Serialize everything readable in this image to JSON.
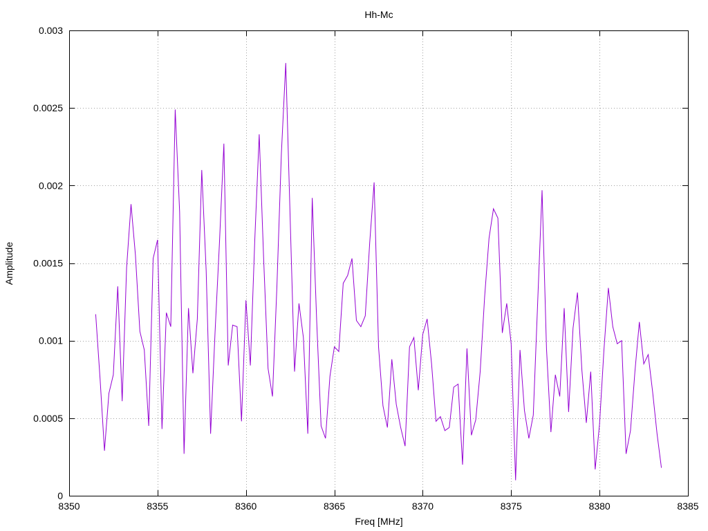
{
  "chart_data": {
    "type": "line",
    "title": "Hh-Mc",
    "xlabel": "Freq [MHz]",
    "ylabel": "Amplitude",
    "xlim": [
      8350,
      8385
    ],
    "ylim": [
      0,
      0.003
    ],
    "x_ticks": [
      8350,
      8355,
      8360,
      8365,
      8370,
      8375,
      8380,
      8385
    ],
    "x_tick_labels": [
      "8350",
      "8355",
      "8360",
      "8365",
      "8370",
      "8375",
      "8380",
      "8385"
    ],
    "y_ticks": [
      0,
      0.0005,
      0.001,
      0.0015,
      0.002,
      0.0025,
      0.003
    ],
    "y_tick_labels": [
      "0",
      "0.0005",
      "0.001",
      "0.0015",
      "0.002",
      "0.0025",
      "0.003"
    ],
    "grid": true,
    "series": [
      {
        "color": "#9400d3",
        "x": [
          8351.5,
          8351.75,
          8352,
          8352.25,
          8352.5,
          8352.75,
          8353,
          8353.25,
          8353.5,
          8353.75,
          8354,
          8354.25,
          8354.5,
          8354.75,
          8355,
          8355.25,
          8355.5,
          8355.75,
          8356,
          8356.25,
          8356.5,
          8356.75,
          8357,
          8357.25,
          8357.5,
          8357.75,
          8358,
          8358.25,
          8358.5,
          8358.75,
          8359,
          8359.25,
          8359.5,
          8359.75,
          8360,
          8360.25,
          8360.5,
          8360.75,
          8361,
          8361.25,
          8361.5,
          8361.75,
          8362,
          8362.25,
          8362.5,
          8362.75,
          8363,
          8363.25,
          8363.5,
          8363.75,
          8364,
          8364.25,
          8364.5,
          8364.75,
          8365,
          8365.25,
          8365.5,
          8365.75,
          8366,
          8366.25,
          8366.5,
          8366.75,
          8367,
          8367.25,
          8367.5,
          8367.75,
          8368,
          8368.25,
          8368.5,
          8368.75,
          8369,
          8369.25,
          8369.5,
          8369.75,
          8370,
          8370.25,
          8370.5,
          8370.75,
          8371,
          8371.25,
          8371.5,
          8371.75,
          8372,
          8372.25,
          8372.5,
          8372.75,
          8373,
          8373.25,
          8373.5,
          8373.75,
          8374,
          8374.25,
          8374.5,
          8374.75,
          8375,
          8375.25,
          8375.5,
          8375.75,
          8376,
          8376.25,
          8376.5,
          8376.75,
          8377,
          8377.25,
          8377.5,
          8377.75,
          8378,
          8378.25,
          8378.5,
          8378.75,
          8379,
          8379.25,
          8379.5,
          8379.75,
          8380,
          8380.25,
          8380.5,
          8380.75,
          8381,
          8381.25,
          8381.5,
          8381.75,
          8382,
          8382.25,
          8382.5,
          8382.75,
          8383,
          8383.25,
          8383.5
        ],
        "y": [
          0.00117,
          0.00075,
          0.00029,
          0.00066,
          0.00078,
          0.00135,
          0.00061,
          0.00147,
          0.00188,
          0.00155,
          0.00106,
          0.00094,
          0.00045,
          0.00153,
          0.00165,
          0.00043,
          0.00118,
          0.00109,
          0.00249,
          0.00183,
          0.00027,
          0.00121,
          0.00079,
          0.00114,
          0.0021,
          0.00145,
          0.0004,
          0.00105,
          0.00163,
          0.00227,
          0.00084,
          0.0011,
          0.00109,
          0.00048,
          0.00126,
          0.00084,
          0.00165,
          0.00233,
          0.00153,
          0.00082,
          0.00064,
          0.00135,
          0.0022,
          0.00279,
          0.0018,
          0.0008,
          0.00124,
          0.00102,
          0.0004,
          0.00192,
          0.00113,
          0.00045,
          0.00037,
          0.00077,
          0.00096,
          0.00093,
          0.00137,
          0.00142,
          0.00153,
          0.00113,
          0.00109,
          0.00116,
          0.00163,
          0.00202,
          0.00096,
          0.00058,
          0.00044,
          0.00088,
          0.00059,
          0.00044,
          0.00032,
          0.00096,
          0.00102,
          0.00068,
          0.00104,
          0.00114,
          0.00085,
          0.00048,
          0.00051,
          0.00042,
          0.00044,
          0.0007,
          0.00072,
          0.0002,
          0.00095,
          0.00039,
          0.00049,
          0.0008,
          0.00128,
          0.00166,
          0.00185,
          0.00179,
          0.00105,
          0.00124,
          0.00098,
          0.0001,
          0.00094,
          0.00055,
          0.00037,
          0.00052,
          0.00124,
          0.00197,
          0.00095,
          0.00041,
          0.00078,
          0.00064,
          0.00121,
          0.00054,
          0.00108,
          0.00131,
          0.00081,
          0.00047,
          0.0008,
          0.00017,
          0.00046,
          0.00094,
          0.00134,
          0.00109,
          0.00098,
          0.001,
          0.00027,
          0.00042,
          0.0008,
          0.00112,
          0.00085,
          0.00091,
          0.00067,
          0.0004,
          0.00018
        ]
      }
    ]
  }
}
